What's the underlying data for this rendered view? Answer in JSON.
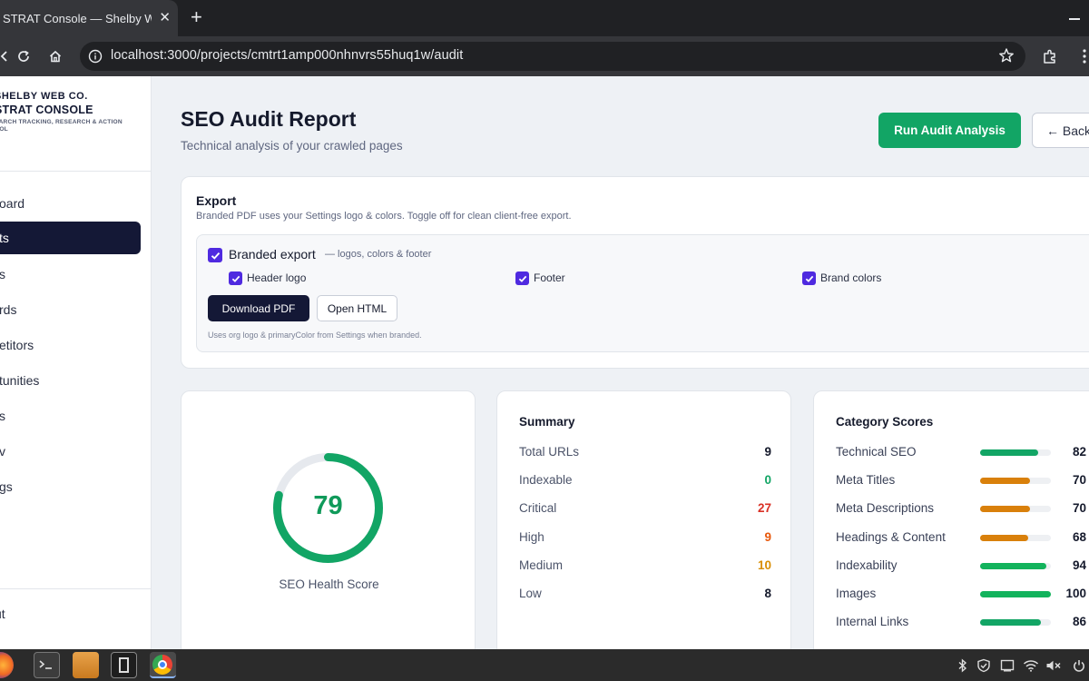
{
  "browser": {
    "tab_title": "STRAT Console — Shelby We",
    "tab_close": "✕",
    "new_tab": "+",
    "url": "localhost:3000/projects/cmtrt1amp000nhnvrs55huq1w/audit"
  },
  "sidebar": {
    "brand_company": "SHELBY WEB CO.",
    "brand_console": "STRAT CONSOLE",
    "brand_tagline_1": "EARCH TRACKING, RESEARCH & ACTION",
    "brand_tagline_2": "OOL",
    "items": [
      {
        "label": "oard"
      },
      {
        "label": "ts"
      },
      {
        "label": "s"
      },
      {
        "label": "rds"
      },
      {
        "label": "etitors"
      },
      {
        "label": "tunities"
      },
      {
        "label": "s"
      },
      {
        "label": "v"
      },
      {
        "label": "gs"
      }
    ],
    "logout": "ut"
  },
  "header": {
    "title": "SEO Audit Report",
    "subtitle": "Technical analysis of your crawled pages",
    "run_button": "Run Audit Analysis",
    "back_button": "← Back"
  },
  "export": {
    "title": "Export",
    "description": "Branded PDF uses your Settings logo & colors. Toggle off for clean client-free export.",
    "branded_label": "Branded export",
    "branded_note": "— logos, colors & footer",
    "options": [
      {
        "label": "Header logo",
        "checked": true
      },
      {
        "label": "Footer",
        "checked": true
      },
      {
        "label": "Brand colors",
        "checked": true
      }
    ],
    "download_pdf": "Download PDF",
    "open_html": "Open HTML",
    "footnote": "Uses org logo & primaryColor from Settings when branded."
  },
  "health": {
    "score": "79",
    "score_fraction": 0.79,
    "label": "SEO Health Score",
    "color": "#12a565"
  },
  "summary": {
    "title": "Summary",
    "rows": [
      {
        "label": "Total URLs",
        "value": "9",
        "color": "#151a2c"
      },
      {
        "label": "Indexable",
        "value": "0",
        "color": "#12a565"
      },
      {
        "label": "Critical",
        "value": "27",
        "color": "#d93025"
      },
      {
        "label": "High",
        "value": "9",
        "color": "#e8590c"
      },
      {
        "label": "Medium",
        "value": "10",
        "color": "#d98e04"
      },
      {
        "label": "Low",
        "value": "8",
        "color": "#151a2c"
      }
    ]
  },
  "categories": {
    "title": "Category Scores",
    "rows": [
      {
        "label": "Technical SEO",
        "value": "82",
        "score": 82,
        "color": "#12a565"
      },
      {
        "label": "Meta Titles",
        "value": "70",
        "score": 70,
        "color": "#d9800b"
      },
      {
        "label": "Meta Descriptions",
        "value": "70",
        "score": 70,
        "color": "#d9800b"
      },
      {
        "label": "Headings & Content",
        "value": "68",
        "score": 68,
        "color": "#d9800b"
      },
      {
        "label": "Indexability",
        "value": "94",
        "score": 94,
        "color": "#12b35c"
      },
      {
        "label": "Images",
        "value": "100",
        "score": 100,
        "color": "#12b35c"
      },
      {
        "label": "Internal Links",
        "value": "86",
        "score": 86,
        "color": "#12a565"
      }
    ]
  }
}
